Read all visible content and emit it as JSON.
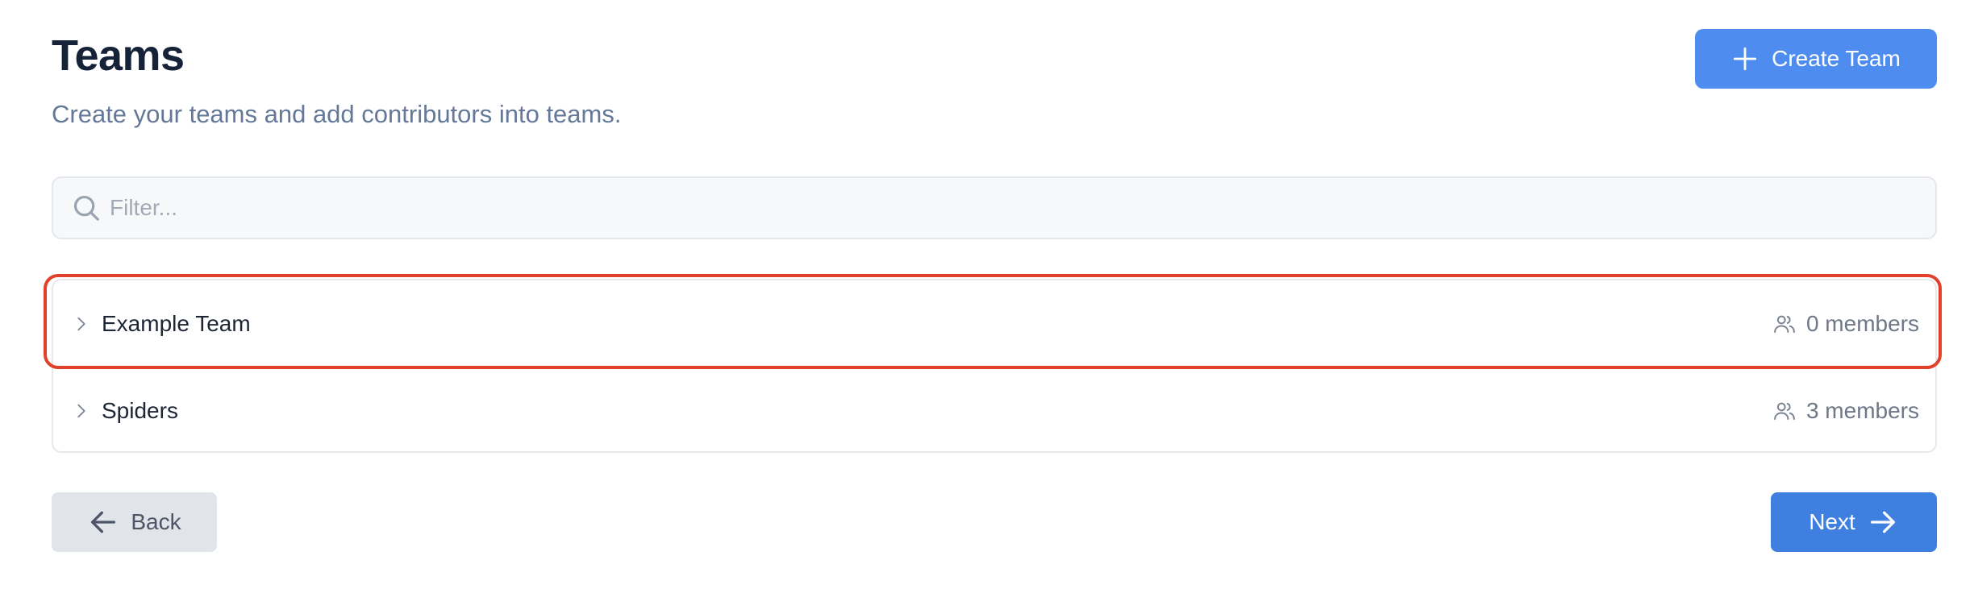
{
  "header": {
    "title": "Teams",
    "subtitle": "Create your teams and add contributors into teams.",
    "create_button_label": "Create Team"
  },
  "filter": {
    "placeholder": "Filter...",
    "value": ""
  },
  "teams": [
    {
      "name": "Example Team",
      "members_label": "0 members",
      "highlighted": true
    },
    {
      "name": "Spiders",
      "members_label": "3 members",
      "highlighted": false
    }
  ],
  "footer": {
    "back_label": "Back",
    "next_label": "Next"
  },
  "colors": {
    "primary": "#4f8cf0",
    "next": "#3f7fe0",
    "highlight": "#e1402b",
    "secondary_bg": "#e1e4e9"
  },
  "icons": {
    "create": "plus-icon",
    "filter": "search-icon",
    "row_expand": "chevron-right-icon",
    "members": "users-icon",
    "back": "arrow-left-icon",
    "next": "arrow-right-icon"
  }
}
